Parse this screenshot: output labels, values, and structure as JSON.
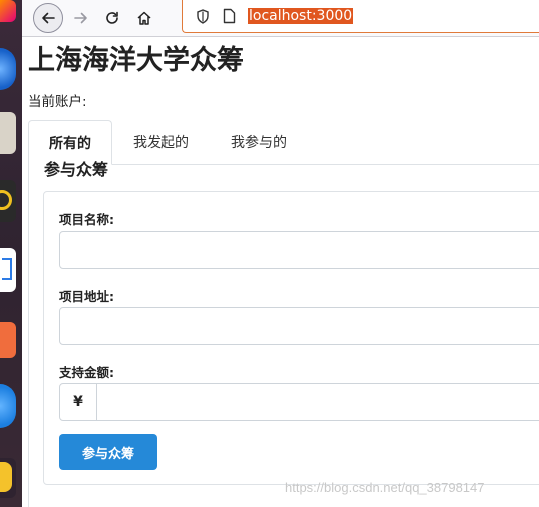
{
  "browser": {
    "url": "localhost:3000",
    "icons": [
      "back-arrow-icon",
      "forward-arrow-icon",
      "reload-icon",
      "home-icon",
      "shield-icon",
      "page-icon"
    ]
  },
  "page": {
    "title": "上海海洋大学众筹",
    "account_label": "当前账户:"
  },
  "tabs": [
    {
      "label": "所有的",
      "active": true
    },
    {
      "label": "我发起的",
      "active": false
    },
    {
      "label": "我参与的",
      "active": false
    }
  ],
  "section": {
    "title": "参与众筹"
  },
  "form": {
    "name_label": "项目名称:",
    "name_value": "",
    "address_label": "项目地址:",
    "address_value": "",
    "amount_label": "支持金额:",
    "currency_symbol": "¥",
    "amount_value": "",
    "submit_label": "参与众筹"
  },
  "watermark": "https://blog.csdn.net/qq_38798147",
  "colors": {
    "primary_button": "#2589d8",
    "url_highlight": "#e0571f"
  }
}
